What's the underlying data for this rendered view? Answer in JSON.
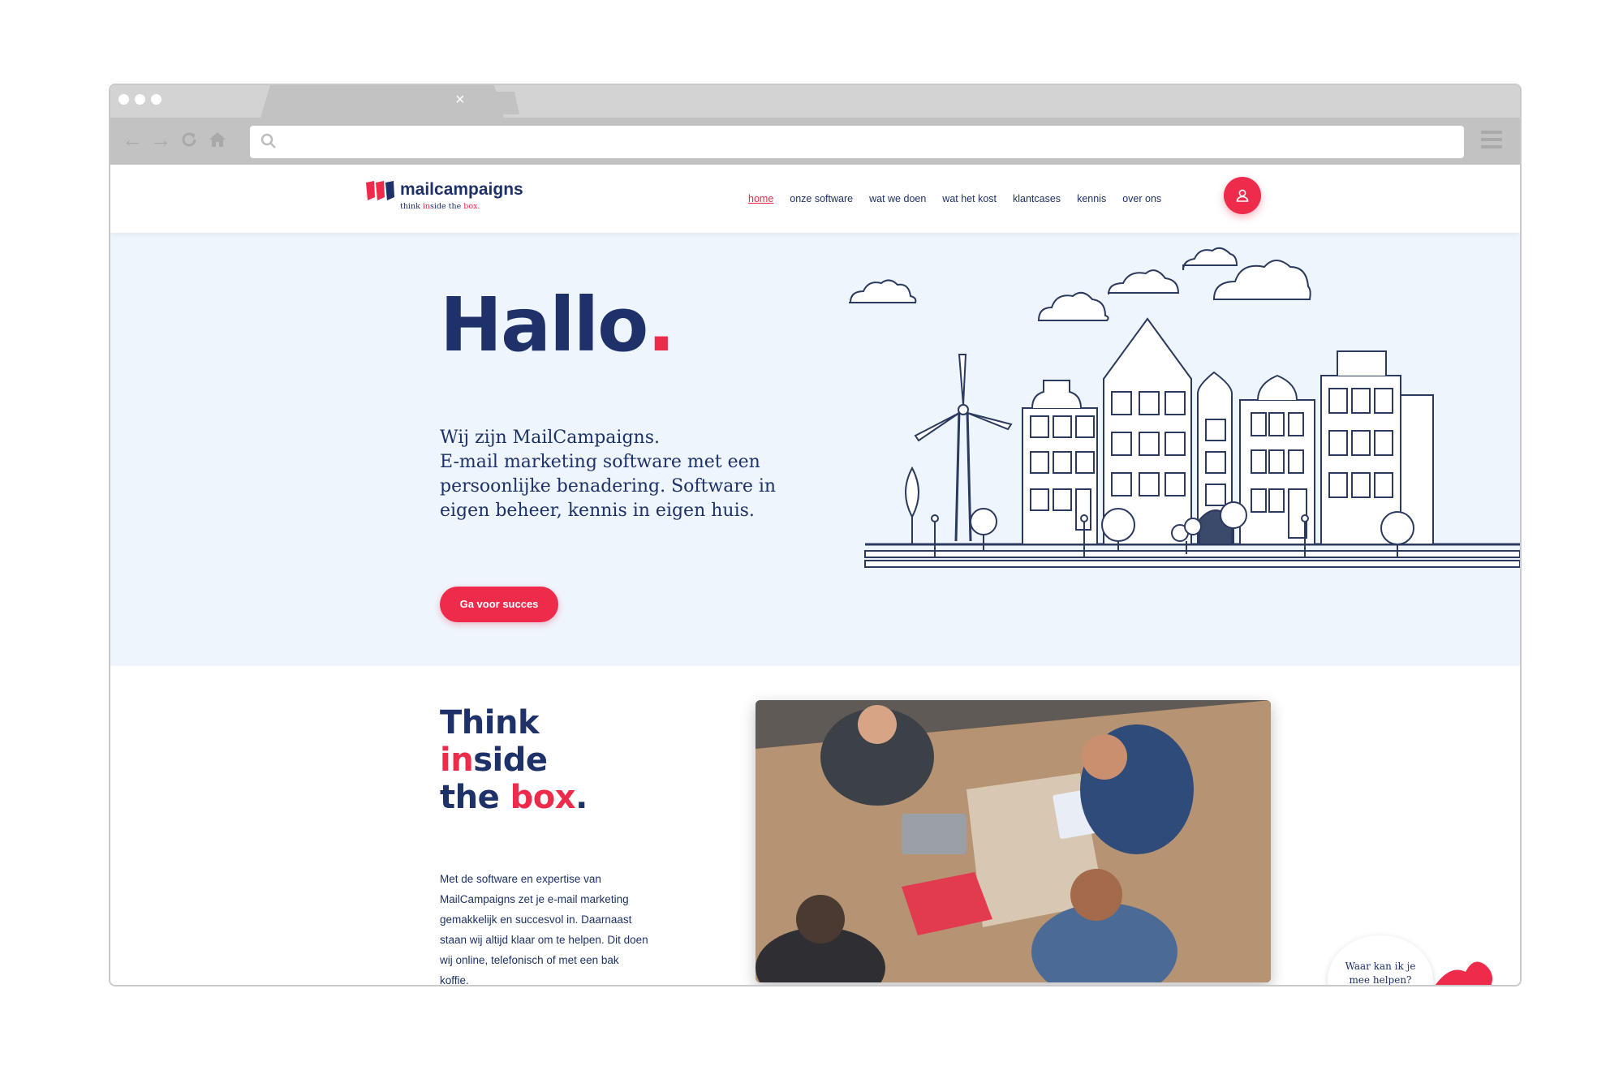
{
  "browser": {
    "tab_close": "×",
    "icons": [
      "back-arrow-icon",
      "forward-arrow-icon",
      "reload-icon",
      "home-icon",
      "search-icon",
      "hamburger-menu-icon"
    ]
  },
  "site": {
    "logo": {
      "name": "mailcampaigns",
      "tagline_pre": "think ",
      "tagline_in": "in",
      "tagline_mid": "side the ",
      "tagline_box": "box."
    },
    "nav": [
      {
        "label": "home",
        "active": true
      },
      {
        "label": "onze software",
        "active": false
      },
      {
        "label": "wat we doen",
        "active": false
      },
      {
        "label": "wat het kost",
        "active": false
      },
      {
        "label": "klantcases",
        "active": false
      },
      {
        "label": "kennis",
        "active": false
      },
      {
        "label": "over ons",
        "active": false
      }
    ],
    "user_icon": "user-icon"
  },
  "hero": {
    "title": "Hallo",
    "title_dot": ".",
    "text_lines": [
      "Wij zijn MailCampaigns.",
      "E-mail marketing software met een",
      "persoonlijke benadering. Software in",
      "eigen beheer, kennis in eigen huis."
    ],
    "cta": "Ga voor succes"
  },
  "intro": {
    "heading_line1": "Think",
    "heading_line2_red": "in",
    "heading_line2_rest": "side",
    "heading_line3_a": "the ",
    "heading_line3_red": "box",
    "heading_line3_dot": ".",
    "body": "Met de software en expertise van MailCampaigns zet je e-mail marketing gemakkelijk en succesvol in. Daarnaast staan wij altijd klaar om te helpen. Dit doen wij online, telefonisch of met een bak koffie."
  },
  "chat": {
    "line1": "Waar kan ik je",
    "line2": "mee helpen?"
  },
  "colors": {
    "brand_navy": "#1e3168",
    "brand_red": "#ef2b4c",
    "hero_bg": "#eef5fc"
  }
}
